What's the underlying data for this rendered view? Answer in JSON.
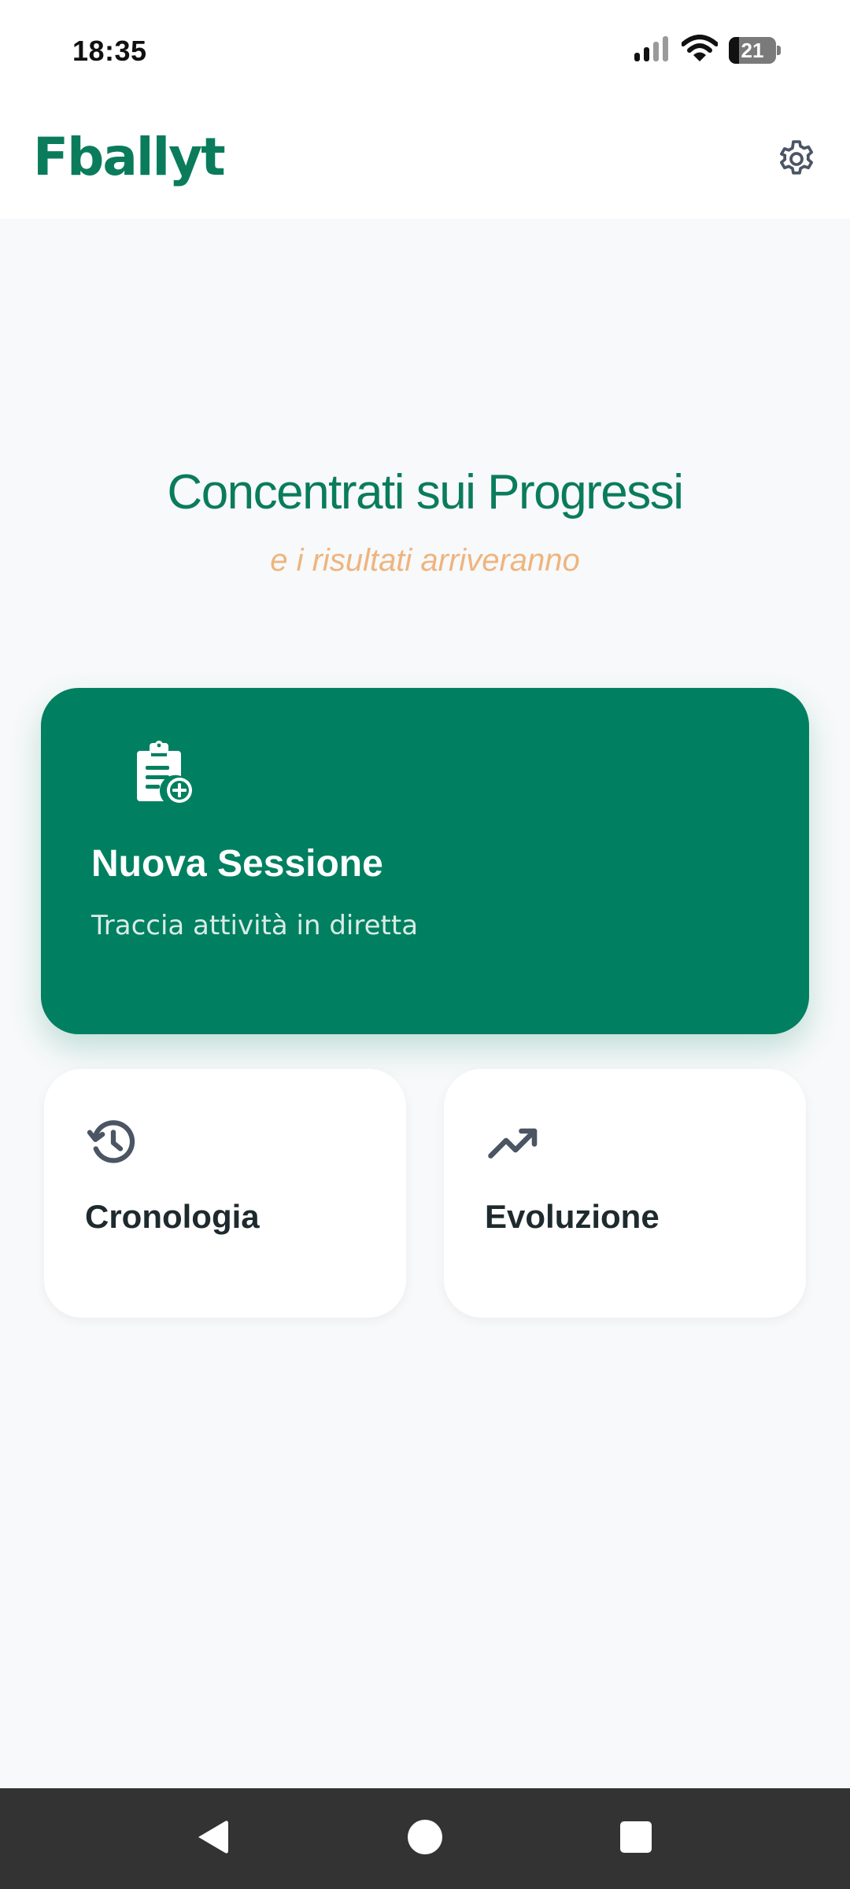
{
  "status_bar": {
    "time": "18:35",
    "battery_level": "21",
    "icons": [
      "cellular-signal-icon",
      "wifi-icon",
      "battery-icon"
    ]
  },
  "header": {
    "logo_text": "Fballyt",
    "settings_icon": "gear-icon"
  },
  "hero": {
    "title": "Concentrati sui Progressi",
    "subtitle": "e i risultati arriveranno"
  },
  "actions": {
    "new_session": {
      "title": "Nuova Sessione",
      "description": "Traccia attività in diretta",
      "icon": "clipboard-add-icon"
    },
    "history": {
      "title": "Cronologia",
      "icon": "history-icon"
    },
    "evolution": {
      "title": "Evoluzione",
      "icon": "trending-up-icon"
    }
  },
  "navigation": {
    "icons": [
      "back-icon",
      "home-icon",
      "recents-icon"
    ]
  },
  "colors": {
    "primary": "#008060",
    "brand_text": "#0A7C5C",
    "accent": "#EFB47E",
    "background": "#F7F9FA",
    "card": "#FFFFFF",
    "icon_gray": "#4B5563",
    "nav_bar": "#333333"
  }
}
